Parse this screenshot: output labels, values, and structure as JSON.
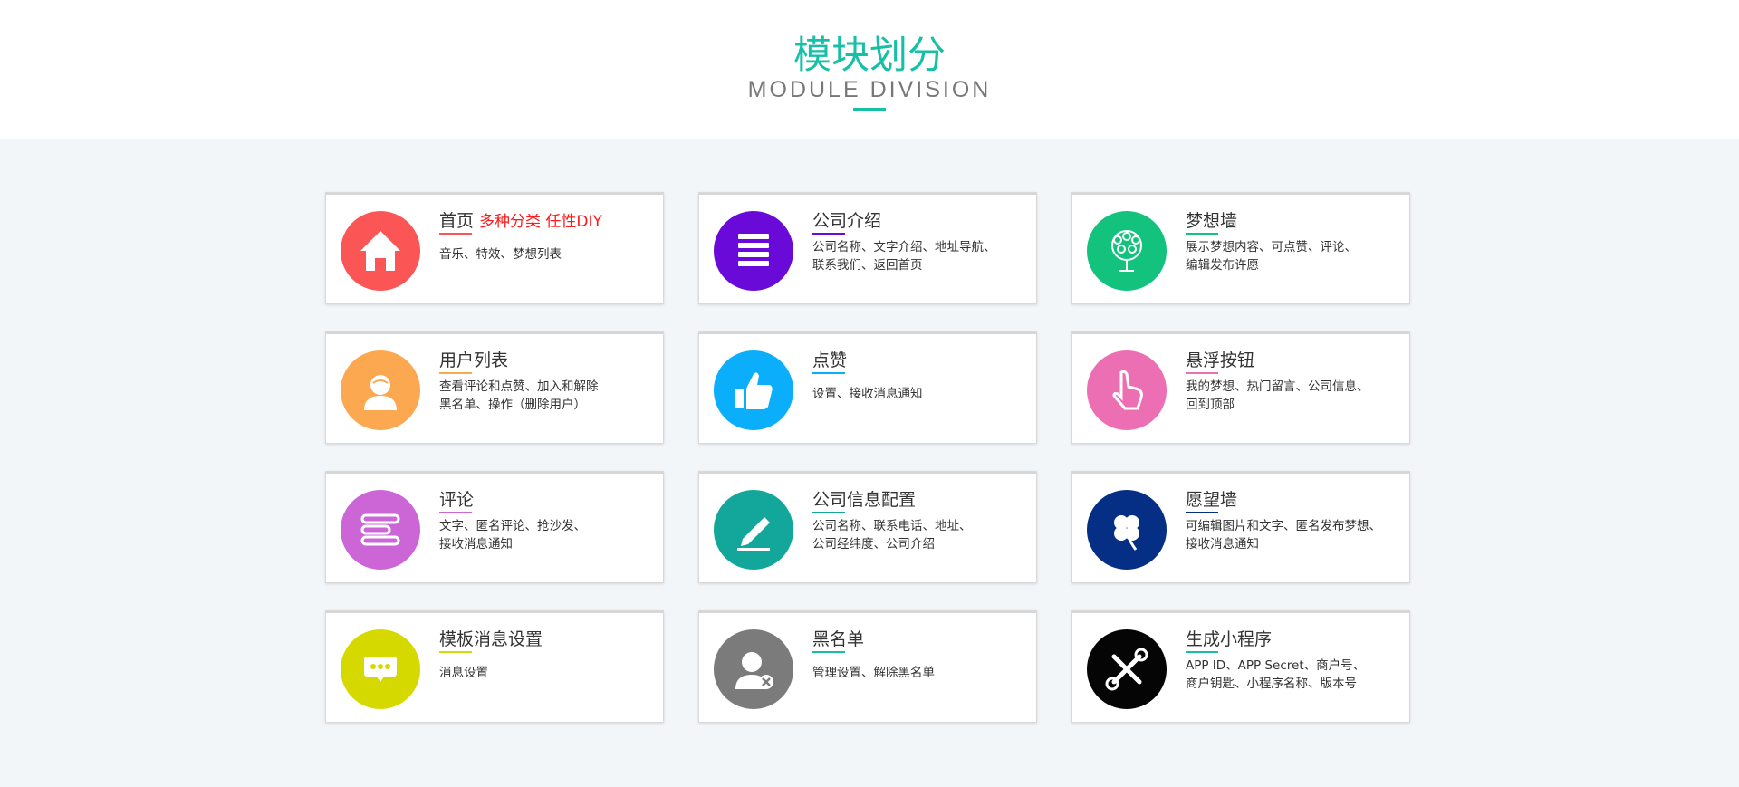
{
  "header": {
    "title_cn": "模块划分",
    "title_en": "MODULE DIVISION"
  },
  "colors": {
    "accent": "#16c0a7",
    "background": "#f3f6f9"
  },
  "cards": [
    {
      "title": "首页",
      "extra": "多种分类  任性DIY",
      "desc": [
        "音乐、特效、梦想列表"
      ],
      "icon": "home-icon",
      "color": "#fb5555",
      "bar": "#fb5555"
    },
    {
      "title": "公司介绍",
      "desc": [
        "公司名称、文字介绍、地址导航、",
        "联系我们、返回首页"
      ],
      "icon": "stack-icon",
      "color": "#6a0ad8",
      "bar": "#6a0ad8"
    },
    {
      "title": "梦想墙",
      "desc": [
        "展示梦想内容、可点赞、评论、",
        "编辑发布许愿"
      ],
      "icon": "tree-icon",
      "color": "#13c37d",
      "bar": "#13c37d"
    },
    {
      "title": "用户列表",
      "desc": [
        "查看评论和点赞、加入和解除",
        "黑名单、操作（删除用户）"
      ],
      "icon": "user-icon",
      "color": "#fca851",
      "bar": "#fca851"
    },
    {
      "title": "点赞",
      "desc": [
        "设置、接收消息通知"
      ],
      "icon": "thumbs-up-icon",
      "color": "#0aaefb",
      "bar": "#0aaefb"
    },
    {
      "title": "悬浮按钮",
      "desc": [
        "我的梦想、热门留言、公司信息、",
        "回到顶部"
      ],
      "icon": "pointer-hand-icon",
      "color": "#ec6fb4",
      "bar": "#ec6fb4"
    },
    {
      "title": "评论",
      "desc": [
        "文字、匿名评论、抢沙发、",
        "接收消息通知"
      ],
      "icon": "comment-lines-icon",
      "color": "#cc66d7",
      "bar": "#cc66d7"
    },
    {
      "title": "公司信息配置",
      "desc": [
        "公司名称、联系电话、地址、",
        "公司经纬度、公司介绍"
      ],
      "icon": "pencil-icon",
      "color": "#12a79a",
      "bar": "#12a79a"
    },
    {
      "title": "愿望墙",
      "desc": [
        "可编辑图片和文字、匿名发布梦想、",
        "接收消息通知"
      ],
      "icon": "clover-icon",
      "color": "#052f84",
      "bar": "#052f84"
    },
    {
      "title": "模板消息设置",
      "desc": [
        "消息设置"
      ],
      "icon": "chat-bubble-icon",
      "color": "#d6d900",
      "bar": "#d6d900"
    },
    {
      "title": "黑名单",
      "desc": [
        "管理设置、解除黑名单"
      ],
      "icon": "user-remove-icon",
      "color": "#7b7b7b",
      "bar": "#16c0a7"
    },
    {
      "title": "生成小程序",
      "desc": [
        "APP ID、APP Secret、商户号、",
        "商户钥匙、小程序名称、版本号"
      ],
      "icon": "tools-icon",
      "color": "#050505",
      "bar": "#16c0a7"
    }
  ]
}
